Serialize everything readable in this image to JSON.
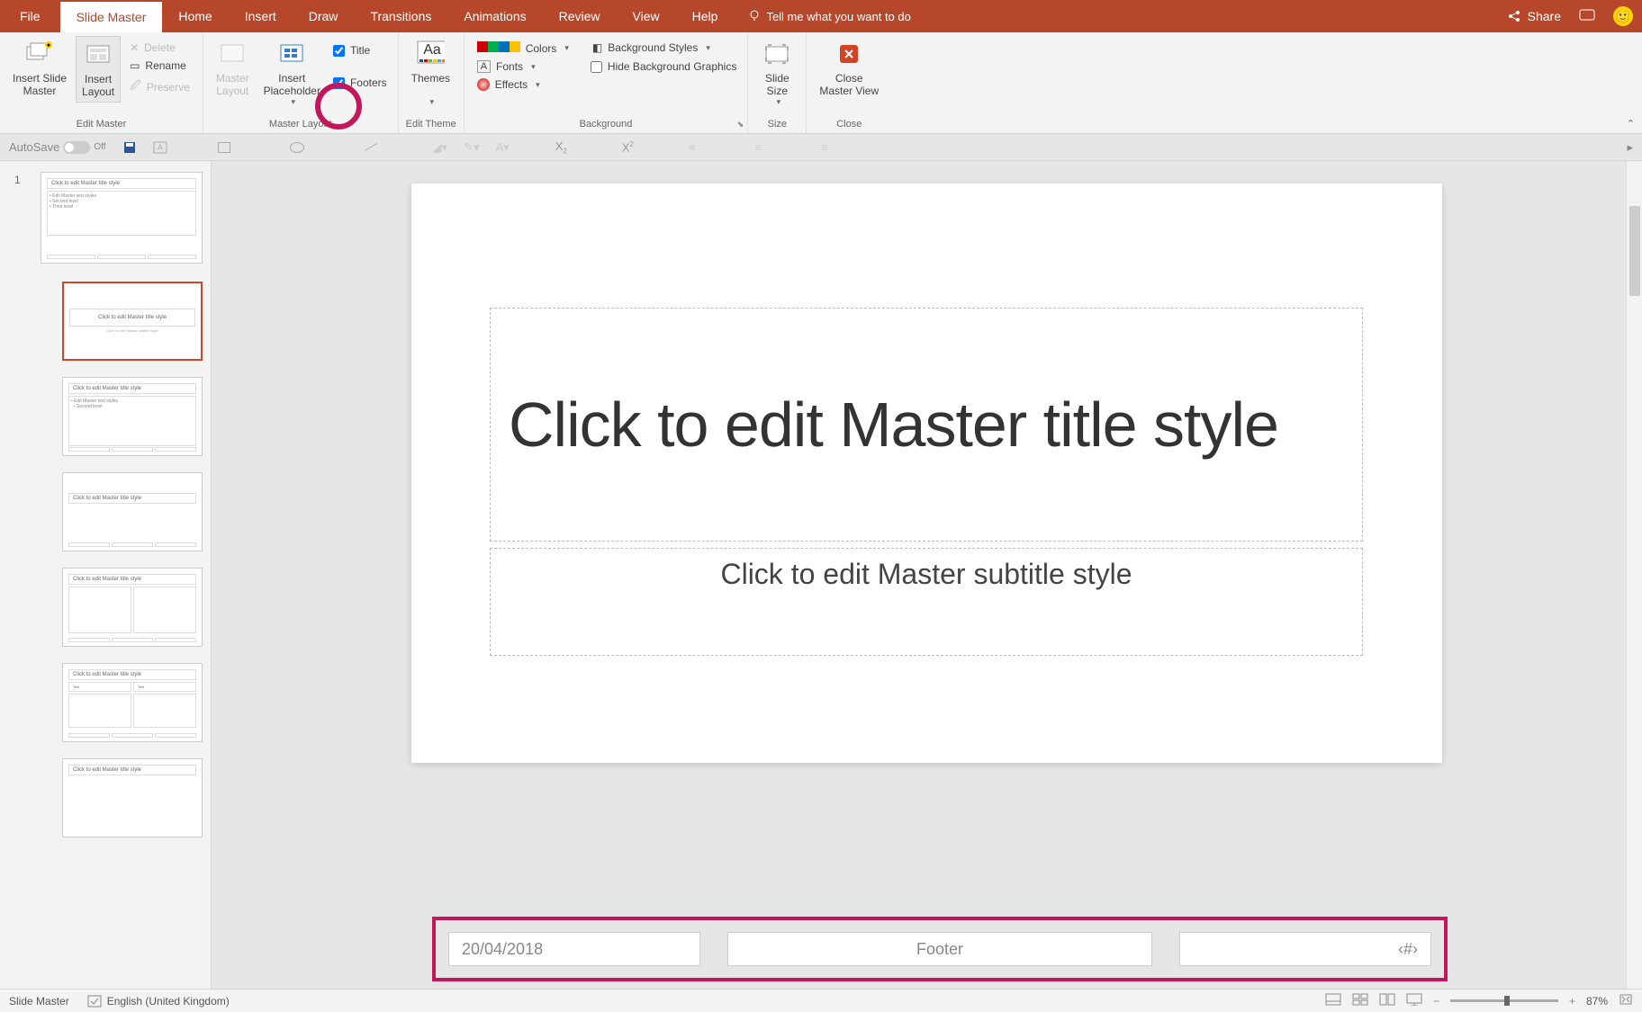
{
  "menubar": {
    "file": "File",
    "slideMaster": "Slide Master",
    "home": "Home",
    "insert": "Insert",
    "draw": "Draw",
    "transitions": "Transitions",
    "animations": "Animations",
    "review": "Review",
    "view": "View",
    "help": "Help",
    "tellMe": "Tell me what you want to do",
    "share": "Share"
  },
  "ribbon": {
    "editMaster": {
      "label": "Edit Master",
      "insertSlideMaster": "Insert Slide\nMaster",
      "insertLayout": "Insert\nLayout",
      "delete": "Delete",
      "rename": "Rename",
      "preserve": "Preserve"
    },
    "masterLayout": {
      "label": "Master Layout",
      "masterLayout": "Master\nLayout",
      "insertPlaceholder": "Insert\nPlaceholder",
      "title": "Title",
      "footers": "Footers"
    },
    "editTheme": {
      "label": "Edit Theme",
      "themes": "Themes"
    },
    "background": {
      "label": "Background",
      "colors": "Colors",
      "fonts": "Fonts",
      "effects": "Effects",
      "backgroundStyles": "Background Styles",
      "hideBackgroundGraphics": "Hide Background Graphics"
    },
    "size": {
      "label": "Size",
      "slideSize": "Slide\nSize"
    },
    "close": {
      "label": "Close",
      "closeMasterView": "Close\nMaster View"
    }
  },
  "qat": {
    "autosave": "AutoSave",
    "off": "Off"
  },
  "slide": {
    "titleText": "Click to edit Master title style",
    "subtitleText": "Click to edit Master subtitle style"
  },
  "footers": {
    "date": "20/04/2018",
    "footer": "Footer",
    "pageNum": "‹#›"
  },
  "thumbs": {
    "masterTitle": "Click to edit Master title style",
    "masterText": "• Edit Master text styles\n    • Second level\n        • Third level"
  },
  "statusbar": {
    "mode": "Slide Master",
    "language": "English (United Kingdom)",
    "zoom": "87%"
  }
}
